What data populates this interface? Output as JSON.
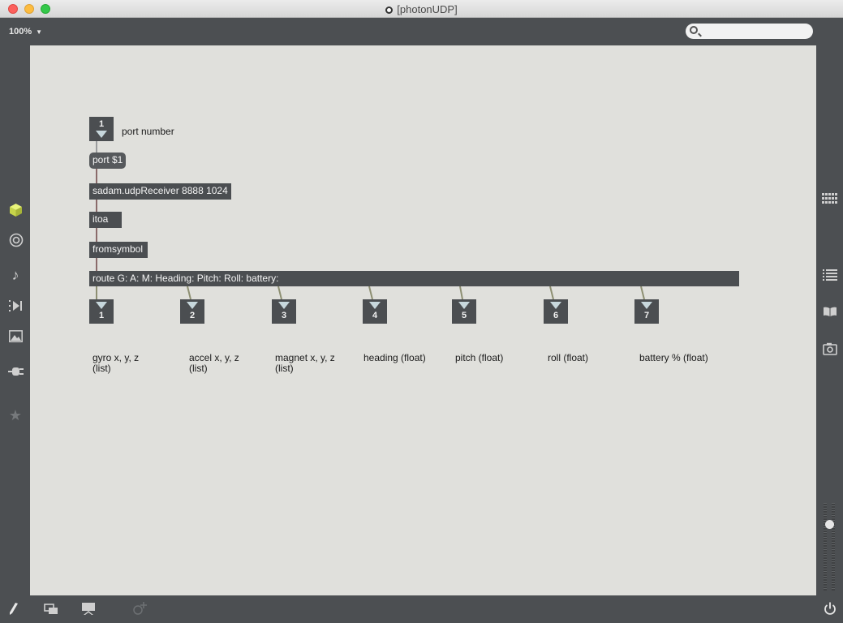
{
  "window": {
    "title": "[photonUDP]"
  },
  "toolbar": {
    "zoom": "100%",
    "search_placeholder": ""
  },
  "objects": {
    "number_box": {
      "value": "1"
    },
    "port_comment": "port number",
    "port_message": "port $1",
    "receiver": "sadam.udpReceiver 8888 1024",
    "itoa": "itoa",
    "fromsymbol": "fromsymbol",
    "route": "route G: A: M: Heading: Pitch: Roll: battery:"
  },
  "outlets": [
    {
      "num": "1",
      "comment_line1": "gyro x, y, z",
      "comment_line2": "(list)"
    },
    {
      "num": "2",
      "comment_line1": "accel x, y, z",
      "comment_line2": "(list)"
    },
    {
      "num": "3",
      "comment_line1": "magnet x, y, z",
      "comment_line2": "(list)"
    },
    {
      "num": "4",
      "comment_line1": "heading (float)",
      "comment_line2": ""
    },
    {
      "num": "5",
      "comment_line1": "pitch (float)",
      "comment_line2": ""
    },
    {
      "num": "6",
      "comment_line1": "roll (float)",
      "comment_line2": ""
    },
    {
      "num": "7",
      "comment_line1": "battery % (float)",
      "comment_line2": ""
    }
  ],
  "left_sidebar_icons": [
    "cube-icon",
    "target-icon",
    "music-note-icon",
    "play-step-icon",
    "image-icon",
    "plug-icon",
    "star-icon"
  ],
  "right_sidebar_icons": [
    "grid-icon",
    "list-icon",
    "book-icon",
    "camera-icon"
  ],
  "bottom_icons": [
    "pencil-icon",
    "windows-icon",
    "presentation-icon",
    "add-extension-icon",
    "power-icon"
  ],
  "colors": {
    "object_bg": "#4b4e51",
    "canvas_bg": "#e0e0dc",
    "chrome": "#4c4f52"
  }
}
